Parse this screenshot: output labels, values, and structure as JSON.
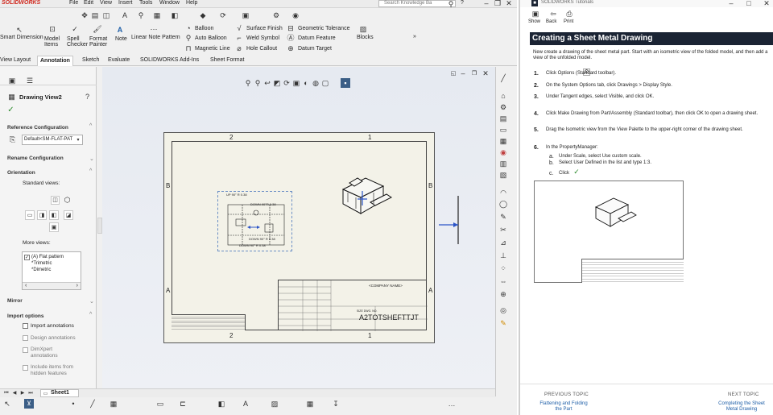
{
  "menu": {
    "brand": "SOLIDWORKS",
    "items": [
      "File",
      "Edit",
      "View",
      "Insert",
      "Tools",
      "Window",
      "Help"
    ],
    "search_placeholder": "Search Knowledge Ba",
    "help": "?"
  },
  "ribbon": {
    "smart_dimension": "Smart Dimension",
    "model_items": "Model Items",
    "spell_checker": "Spell Checker",
    "format_painter": "Format Painter",
    "note": "Note",
    "linear_note_pattern": "Linear Note Pattern",
    "balloon": "Balloon",
    "auto_balloon": "Auto Balloon",
    "magnetic_line": "Magnetic Line",
    "surface_finish": "Surface Finish",
    "weld_symbol": "Weld Symbol",
    "hole_callout": "Hole Callout",
    "geometric_tolerance": "Geometric Tolerance",
    "datum_feature": "Datum Feature",
    "datum_target": "Datum Target",
    "blocks": "Blocks",
    "tabs": [
      "View Layout",
      "Annotation",
      "Sketch",
      "Evaluate",
      "SOLIDWORKS Add-Ins",
      "Sheet Format"
    ],
    "active_tab": "Annotation"
  },
  "property_manager": {
    "title": "Drawing View2",
    "ref_config_header": "Reference Configuration",
    "ref_config_value": "Default<SM-FLAT-PAT",
    "rename_config": "Rename Configuration",
    "orientation_header": "Orientation",
    "standard_views": "Standard views:",
    "more_views": "More views:",
    "more_views_items": [
      "(A) Flat pattern",
      "*Trimetric",
      "*Dimetric"
    ],
    "mirror": "Mirror",
    "import_options": "Import options",
    "import_annotations": "Import annotations",
    "design_annotations": "Design annotations",
    "dimxpert": "DimXpert annotations",
    "include_hidden": "Include items from hidden features"
  },
  "drawing": {
    "zone_top": [
      "2",
      "1"
    ],
    "zone_side": [
      "B",
      "A"
    ],
    "zone_bottom": [
      "2",
      "1"
    ],
    "title_block": {
      "company": "<COMPANY NAME>",
      "doc_no": "A2TOTSHEFTTJT",
      "size": "SIZE DWG. NO."
    },
    "notes": [
      "DOWN 90°R 0.38",
      "DOWN 90° R 0.38",
      "DOWN 90° R 0.38",
      "UP 90° R 0.38"
    ]
  },
  "sheet_tab": "Sheet1",
  "tutorial": {
    "window_title": "SOLIDWORKS Tutorials",
    "toolbar": [
      "Show",
      "Back",
      "Print"
    ],
    "heading": "Creating a Sheet Metal Drawing",
    "intro": "New create a drawing of the sheet metal part. Start with an isometric view of the folded model, and then add a view of the unfolded model.",
    "steps": [
      {
        "num": "1.",
        "text": "Click Options (Standard toolbar)."
      },
      {
        "num": "2.",
        "text": "On the System Options tab, click Drawings > Display Style."
      },
      {
        "num": "3.",
        "text": "Under Tangent edges, select Visible, and click OK."
      },
      {
        "num": "4.",
        "text": "Click Make Drawing from Part/Assembly (Standard toolbar), then click OK to open a drawing sheet."
      },
      {
        "num": "5.",
        "text": "Drag the Isometric view from the View Palette to the upper-right corner of the drawing sheet."
      },
      {
        "num": "6.",
        "text": "In the PropertyManager:"
      }
    ],
    "substeps": [
      {
        "num": "a.",
        "text": "Under Scale, select Use custom scale."
      },
      {
        "num": "b.",
        "text": "Select User Defined in the list and type 1:3."
      },
      {
        "num": "c.",
        "text": "Click"
      }
    ],
    "prev_label": "Previous topic",
    "prev_link": "Flattening and Folding the Part",
    "next_label": "Next topic",
    "next_link": "Completing the Sheet Metal Drawing"
  },
  "colors": {
    "accent_blue": "#1f5fa8",
    "pane_header": "#1b2434",
    "title_red": "#c0392b"
  }
}
